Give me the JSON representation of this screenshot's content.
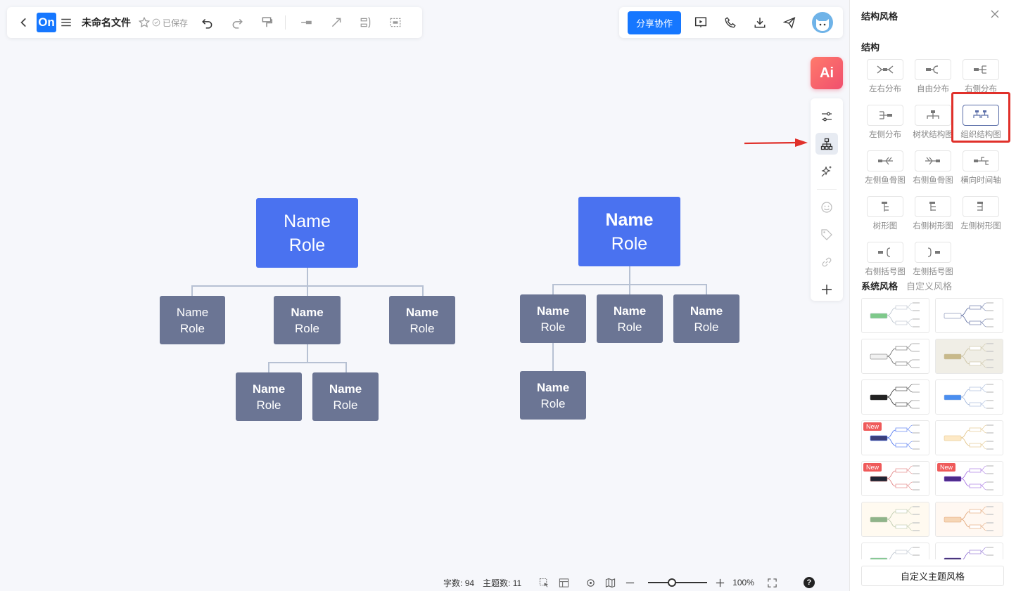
{
  "app": {
    "logo_text": "On",
    "doc_title": "未命名文件",
    "saved_label": "已保存"
  },
  "toolbar": {
    "share_label": "分享协作"
  },
  "ai": {
    "label": "Ai"
  },
  "nodes": {
    "left_root": {
      "name": "Name",
      "role": "Role"
    },
    "left_children": [
      {
        "name": "Name",
        "role": "Role"
      },
      {
        "name": "Name",
        "role": "Role"
      },
      {
        "name": "Name",
        "role": "Role"
      }
    ],
    "left_grandchildren": [
      {
        "name": "Name",
        "role": "Role"
      },
      {
        "name": "Name",
        "role": "Role"
      }
    ],
    "right_root": {
      "name": "Name",
      "role": "Role"
    },
    "right_children": [
      {
        "name": "Name",
        "role": "Role"
      },
      {
        "name": "Name",
        "role": "Role"
      },
      {
        "name": "Name",
        "role": "Role"
      }
    ],
    "right_grandchildren": [
      {
        "name": "Name",
        "role": "Role"
      }
    ]
  },
  "status": {
    "word_count_label": "字数:",
    "word_count": "94",
    "topic_count_label": "主题数:",
    "topic_count": "11",
    "zoom": "100%",
    "zoom_level": 0.4,
    "help": "?"
  },
  "panel": {
    "title": "结构风格",
    "structure_label": "结构",
    "structures": [
      {
        "label": "左右分布",
        "icon": "both-sides-icon"
      },
      {
        "label": "自由分布",
        "icon": "free-layout-icon"
      },
      {
        "label": "右侧分布",
        "icon": "right-layout-icon"
      },
      {
        "label": "左侧分布",
        "icon": "left-layout-icon"
      },
      {
        "label": "树状结构图",
        "icon": "tree-chart-icon"
      },
      {
        "label": "组织结构图",
        "icon": "org-chart-icon",
        "selected": true
      },
      {
        "label": "左侧鱼骨图",
        "icon": "left-fishbone-icon"
      },
      {
        "label": "右侧鱼骨图",
        "icon": "right-fishbone-icon"
      },
      {
        "label": "横向时间轴",
        "icon": "timeline-icon"
      },
      {
        "label": "树形图",
        "icon": "tree-icon"
      },
      {
        "label": "右侧树形图",
        "icon": "right-tree-icon"
      },
      {
        "label": "左侧树形图",
        "icon": "left-tree-icon"
      },
      {
        "label": "右侧括号图",
        "icon": "right-bracket-icon"
      },
      {
        "label": "左侧括号图",
        "icon": "left-bracket-icon"
      }
    ],
    "style_tabs": [
      {
        "label": "系统风格",
        "active": true
      },
      {
        "label": "自定义风格",
        "active": false
      }
    ],
    "themes": [
      {
        "root_color": "#7ec98a",
        "line_color": "#b9c2cc",
        "bg": "#ffffff",
        "new": false
      },
      {
        "root_color": "#ffffff",
        "line_color": "#5a6a9e",
        "bg": "#ffffff",
        "new": false
      },
      {
        "root_color": "#f1f1f1",
        "line_color": "#666666",
        "bg": "#ffffff",
        "new": false
      },
      {
        "root_color": "#c8b98a",
        "line_color": "#c9c0a0",
        "bg": "#f0eee6",
        "new": false
      },
      {
        "root_color": "#222222",
        "line_color": "#333333",
        "bg": "#ffffff",
        "new": false
      },
      {
        "root_color": "#4a8ef0",
        "line_color": "#9db3d8",
        "bg": "#ffffff",
        "new": false
      },
      {
        "root_color": "#3b3f7a",
        "line_color": "#4a72f0",
        "bg": "#ffffff",
        "new": true,
        "badge": "New"
      },
      {
        "root_color": "#fde9c6",
        "line_color": "#e0c080",
        "bg": "#ffffff",
        "new": false
      },
      {
        "root_color": "#1f2432",
        "line_color": "#e07a7a",
        "bg": "#ffffff",
        "new": true,
        "badge": "New"
      },
      {
        "root_color": "#4b2a8a",
        "line_color": "#a069e0",
        "bg": "#ffffff",
        "new": true,
        "badge": "New"
      },
      {
        "root_color": "#8fb48a",
        "line_color": "#b8c7a8",
        "bg": "#fffaf0",
        "new": false
      },
      {
        "root_color": "#f6d6b6",
        "line_color": "#e0a070",
        "bg": "#fff8f2",
        "new": false
      },
      {
        "root_color": "#7ec98a",
        "line_color": "#b9c2cc",
        "bg": "#ffffff",
        "new": false
      },
      {
        "root_color": "#3b2a6a",
        "line_color": "#8a6ad0",
        "bg": "#ffffff",
        "new": false
      }
    ],
    "custom_theme_label": "自定义主题风格"
  },
  "colors": {
    "accent": "#1677ff",
    "root_node": "#4a72f0",
    "child_node": "#6b7594",
    "connector": "#b7c1d3",
    "highlight": "#e0302a"
  }
}
